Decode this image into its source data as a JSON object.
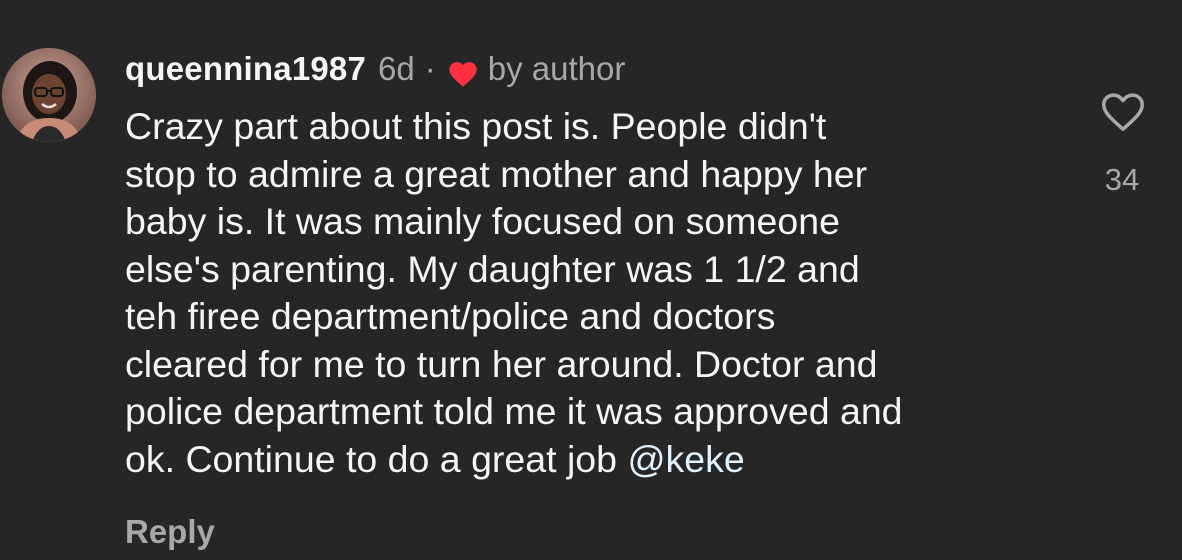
{
  "comment": {
    "username": "queennina1987",
    "time": "6d",
    "separator": "·",
    "badge_icon": "filled-red-heart-icon",
    "badge_text": "by author",
    "text_lines": [
      "Crazy part about this post is. People didn't",
      "stop to admire a great mother and happy her",
      "baby is. It was mainly focused on someone",
      "else's parenting. My daughter was 1 1/2  and",
      "teh firee department/police and doctors",
      "cleared for me to turn her around. Doctor and",
      "police department told me it was approved and"
    ],
    "text_last_line": "ok. Continue to do a great job ",
    "mention": "@keke",
    "reply_label": "Reply",
    "like_icon": "heart-outline-icon",
    "like_count": "34"
  },
  "colors": {
    "background": "#262626",
    "primary_text": "#f5f5f5",
    "secondary_text": "#a8a8a8",
    "mention": "#e0f1ff",
    "heart_red": "#ff3040"
  }
}
